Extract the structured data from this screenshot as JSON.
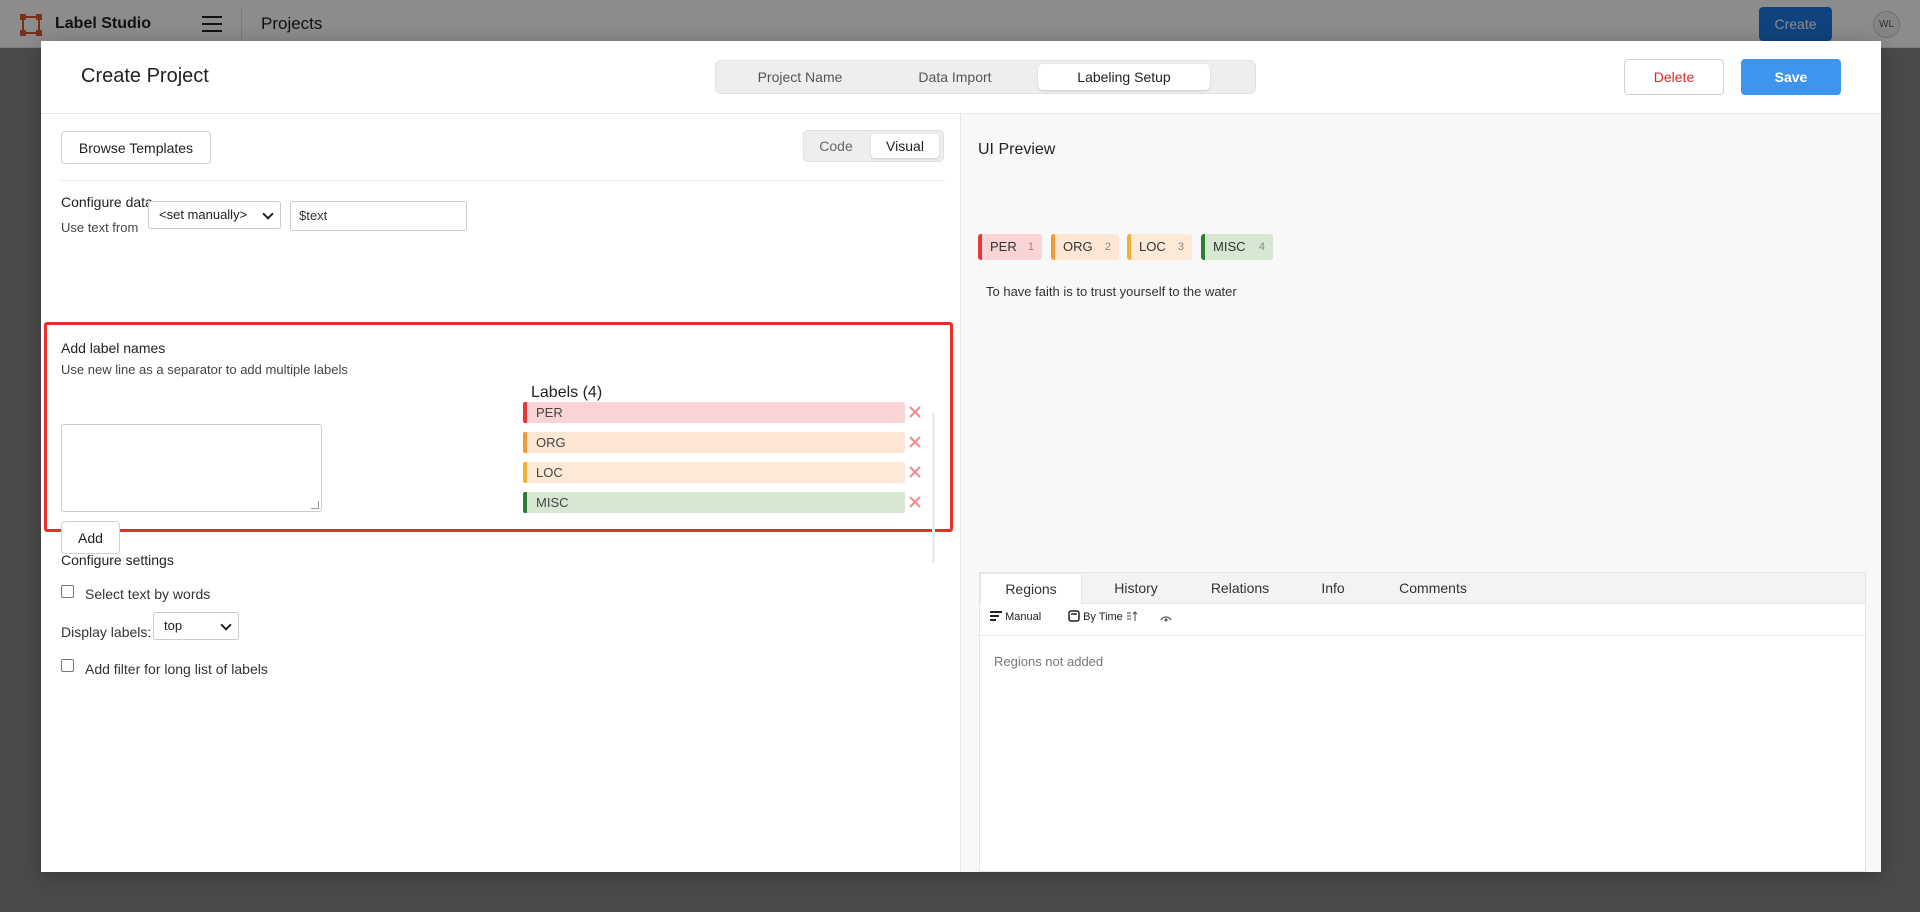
{
  "topbar": {
    "app_title": "Label Studio",
    "section": "Projects",
    "create_label": "Create",
    "avatar_initials": "WL"
  },
  "modal": {
    "title": "Create Project",
    "steps": [
      "Project Name",
      "Data Import",
      "Labeling Setup"
    ],
    "active_step": "Labeling Setup",
    "delete_label": "Delete",
    "save_label": "Save"
  },
  "left": {
    "browse_label": "Browse Templates",
    "view_modes": [
      "Code",
      "Visual"
    ],
    "active_view": "Visual",
    "configure_data": {
      "heading": "Configure data",
      "use_text_from": "Use text from",
      "source_select": "<set manually>",
      "value": "$text"
    },
    "add_labels": {
      "heading": "Add label names",
      "hint": "Use new line as a separator to add multiple labels",
      "textarea_value": "",
      "add_button": "Add"
    },
    "labels": {
      "title": "Labels (4)",
      "items": [
        {
          "name": "PER",
          "color": "#e53935",
          "bg": "#fad4d4"
        },
        {
          "name": "ORG",
          "color": "#f29a37",
          "bg": "#fde6d4"
        },
        {
          "name": "LOC",
          "color": "#f2b134",
          "bg": "#fde9d6"
        },
        {
          "name": "MISC",
          "color": "#2e7d32",
          "bg": "#d6e7d2"
        }
      ]
    },
    "configure_settings": {
      "heading": "Configure settings",
      "select_by_words": "Select text by words",
      "select_by_words_checked": false,
      "display_labels": "Display labels:",
      "display_labels_value": "top",
      "filter_long_list": "Add filter for long list of labels",
      "filter_long_list_checked": false
    }
  },
  "right": {
    "title": "UI Preview",
    "tags": [
      {
        "name": "PER",
        "hotkey": "1",
        "color": "#e53935",
        "bg": "#fad4d4"
      },
      {
        "name": "ORG",
        "hotkey": "2",
        "color": "#f29a37",
        "bg": "#fde6d4"
      },
      {
        "name": "LOC",
        "hotkey": "3",
        "color": "#f2b134",
        "bg": "#fde9d6"
      },
      {
        "name": "MISC",
        "hotkey": "4",
        "color": "#2e7d32",
        "bg": "#d6e7d2"
      }
    ],
    "sample_text": "To have faith is to trust yourself to the water",
    "region_tabs": [
      "Regions",
      "History",
      "Relations",
      "Info",
      "Comments"
    ],
    "active_region_tab": "Regions",
    "tools": {
      "manual": "Manual",
      "by_time": "By Time"
    },
    "empty_message": "Regions not added"
  }
}
